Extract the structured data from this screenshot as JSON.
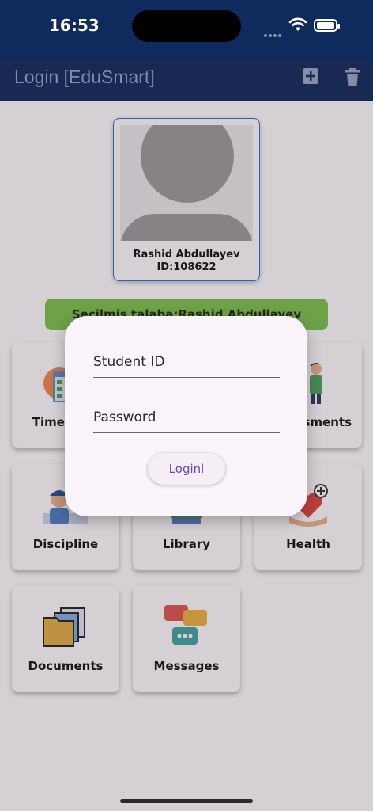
{
  "status": {
    "time": "16:53"
  },
  "appbar": {
    "title": "Login [EduSmart]",
    "add_icon": "add-box-icon",
    "delete_icon": "trash-icon"
  },
  "profile": {
    "name": "Rashid Abdullayev",
    "id": "ID:108622"
  },
  "selected_banner": "Secilmis talaba:Rashid Abdullayev",
  "tiles": [
    {
      "label": "Timetable",
      "icon": "calendar-icon"
    },
    {
      "label": "Assessments",
      "icon": "teacher-icon"
    },
    {
      "label": "Discipline",
      "icon": "student-icon"
    },
    {
      "label": "Library",
      "icon": "books-icon"
    },
    {
      "label": "Health",
      "icon": "heart-hand-icon"
    },
    {
      "label": "Documents",
      "icon": "folder-icon"
    },
    {
      "label": "Messages",
      "icon": "chat-icon"
    }
  ],
  "dialog": {
    "student_id_placeholder": "Student ID",
    "password_placeholder": "Password",
    "login_label": "Loginl"
  },
  "colors": {
    "app_bar": "#0f2a5c",
    "banner": "#7dc44a",
    "accent": "#6a4aa8"
  }
}
